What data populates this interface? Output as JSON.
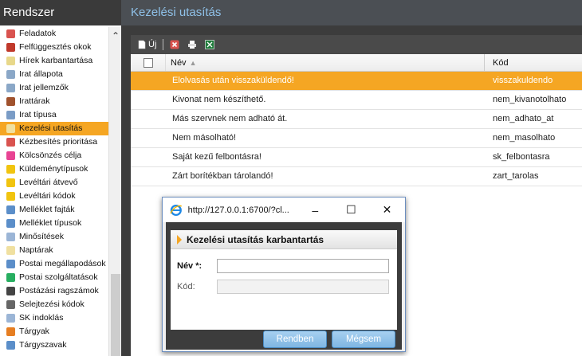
{
  "sidebar": {
    "title": "Rendszer",
    "items": [
      {
        "label": "Feladatok",
        "icon": "tasks-icon",
        "color": "#d9534f"
      },
      {
        "label": "Felfüggesztés okok",
        "icon": "suspend-icon",
        "color": "#c0392b"
      },
      {
        "label": "Hírek karbantartása",
        "icon": "news-icon",
        "color": "#e8d88a"
      },
      {
        "label": "Irat állapota",
        "icon": "doc-status-icon",
        "color": "#8aa7c7"
      },
      {
        "label": "Irat jellemzők",
        "icon": "doc-props-icon",
        "color": "#8aa7c7"
      },
      {
        "label": "Irattárak",
        "icon": "archive-icon",
        "color": "#a0522d"
      },
      {
        "label": "Irat típusa",
        "icon": "doc-type-icon",
        "color": "#7a9cc6"
      },
      {
        "label": "Kezelési utasítás",
        "icon": "instruction-icon",
        "color": "#f0e0a0"
      },
      {
        "label": "Kézbesítés prioritása",
        "icon": "priority-icon",
        "color": "#d9534f"
      },
      {
        "label": "Kölcsönzés célja",
        "icon": "lending-icon",
        "color": "#e84393"
      },
      {
        "label": "Küldeménytípusok",
        "icon": "shipment-type-icon",
        "color": "#f1c40f"
      },
      {
        "label": "Levéltári átvevő",
        "icon": "archive-receiver-icon",
        "color": "#f1c40f"
      },
      {
        "label": "Levéltári kódok",
        "icon": "archive-code-icon",
        "color": "#f1c40f"
      },
      {
        "label": "Melléklet fajták",
        "icon": "attachment-kind-icon",
        "color": "#5b8ec9"
      },
      {
        "label": "Melléklet típusok",
        "icon": "attachment-type-icon",
        "color": "#5b8ec9"
      },
      {
        "label": "Minősítések",
        "icon": "classification-icon",
        "color": "#9bb5d6"
      },
      {
        "label": "Naptárak",
        "icon": "calendar-icon",
        "color": "#f0e0a0"
      },
      {
        "label": "Postai megállapodások",
        "icon": "postal-agreement-icon",
        "color": "#5b8ec9"
      },
      {
        "label": "Postai szolgáltatások",
        "icon": "postal-service-icon",
        "color": "#27ae60"
      },
      {
        "label": "Postázási ragszámok",
        "icon": "postal-label-icon",
        "color": "#444444"
      },
      {
        "label": "Selejtezési kódok",
        "icon": "disposal-code-icon",
        "color": "#666666"
      },
      {
        "label": "SK indoklás",
        "icon": "sk-reason-icon",
        "color": "#9bb5d6"
      },
      {
        "label": "Tárgyak",
        "icon": "subjects-icon",
        "color": "#e67e22"
      },
      {
        "label": "Tárgyszavak",
        "icon": "keywords-icon",
        "color": "#5b8ec9"
      }
    ]
  },
  "main": {
    "title": "Kezelési utasítás",
    "toolbar": {
      "new_label": "Új"
    },
    "columns": {
      "name": "Név",
      "code": "Kód"
    },
    "rows": [
      {
        "name": "Elolvasás után visszaküldendő!",
        "code": "visszakuldendo",
        "selected": true
      },
      {
        "name": "Kivonat nem készíthető.",
        "code": "nem_kivanotolhato"
      },
      {
        "name": "Más szervnek nem adható át.",
        "code": "nem_adhato_at"
      },
      {
        "name": "Nem másolható!",
        "code": "nem_masolhato"
      },
      {
        "name": "Saját kezű felbontásra!",
        "code": "sk_felbontasra"
      },
      {
        "name": "Zárt borítékban tárolandó!",
        "code": "zart_tarolas"
      }
    ]
  },
  "dialog": {
    "url": "http://127.0.0.1:6700/?cl...",
    "panel_title": "Kezelési utasítás karbantartás",
    "name_label": "Név *:",
    "name_value": "",
    "code_label": "Kód:",
    "code_value": "",
    "ok_label": "Rendben",
    "cancel_label": "Mégsem"
  },
  "colors": {
    "accent": "#f5a623",
    "header_title": "#8fc1e8",
    "button": "#7fb6e3"
  }
}
